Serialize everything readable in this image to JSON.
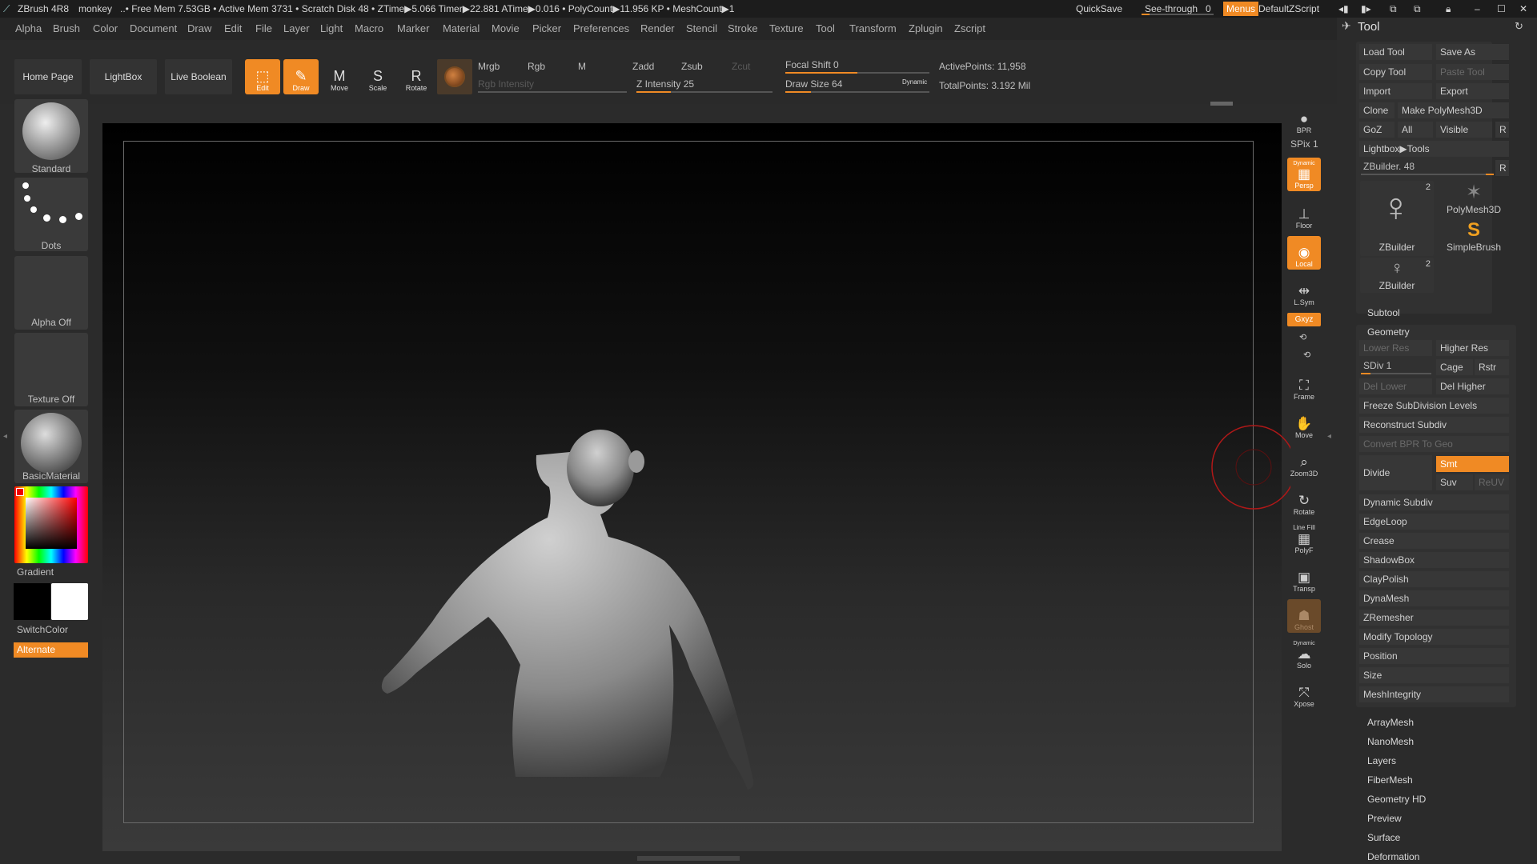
{
  "titlebar": {
    "app": "ZBrush 4R8",
    "doc": "monkey",
    "stats": "..• Free Mem 7.53GB • Active Mem 3731 • Scratch Disk 48 •  ZTime▶5.066 Timer▶22.881 ATime▶0.016 • PolyCount▶11.956 KP  • MeshCount▶1",
    "quicksave": "QuickSave",
    "seethrough": "See-through",
    "seethrough_value": "0",
    "menus": "Menus",
    "script": "DefaultZScript"
  },
  "menu": [
    "Alpha",
    "Brush",
    "Color",
    "Document",
    "Draw",
    "Edit",
    "File",
    "Layer",
    "Light",
    "Macro",
    "Marker",
    "Material",
    "Movie",
    "Picker",
    "Preferences",
    "Render",
    "Stencil",
    "Stroke",
    "Texture",
    "Tool",
    "Transform",
    "Zplugin",
    "Zscript"
  ],
  "toolbar": {
    "home": "Home Page",
    "lightbox": "LightBox",
    "live_boolean": "Live Boolean",
    "edit": "Edit",
    "draw": "Draw",
    "move": "Move",
    "scale": "Scale",
    "rotate": "Rotate",
    "mrgb": "Mrgb",
    "rgb": "Rgb",
    "m": "M",
    "rgb_intensity": "Rgb Intensity",
    "zadd": "Zadd",
    "zsub": "Zsub",
    "zcut": "Zcut",
    "z_intensity": "Z Intensity 25",
    "focal_shift": "Focal Shift 0",
    "draw_size": "Draw Size 64",
    "dynamic": "Dynamic",
    "active_points": "ActivePoints: 11,958",
    "total_points": "TotalPoints: 3.192 Mil",
    "z_intensity_value": 0.25,
    "draw_size_value": 0.18,
    "focal_shift_value": 0.5
  },
  "left": {
    "standard": "Standard",
    "dots": "Dots",
    "alpha_off": "Alpha Off",
    "texture_off": "Texture Off",
    "material": "BasicMaterial",
    "gradient": "Gradient",
    "switchcolor": "SwitchColor",
    "alternate": "Alternate"
  },
  "right": {
    "bpr": "BPR",
    "spix": "SPix 1",
    "persp": "Persp",
    "dynamic": "Dynamic",
    "floor": "Floor",
    "local": "Local",
    "lsym": "L.Sym",
    "xyz": "Gxyz",
    "frame": "Frame",
    "move": "Move",
    "zoom": "Zoom3D",
    "rotate": "Rotate",
    "linefill": "Line Fill",
    "polyf": "PolyF",
    "transp": "Transp",
    "ghost": "Ghost",
    "solo": "Solo",
    "xpose": "Xpose"
  },
  "tool": {
    "title": "Tool",
    "load": "Load Tool",
    "save_as": "Save As",
    "copy": "Copy Tool",
    "paste": "Paste Tool",
    "import": "Import",
    "export": "Export",
    "clone": "Clone",
    "make_polymesh": "Make PolyMesh3D",
    "goz": "GoZ",
    "all": "All",
    "visible": "Visible",
    "r": "R",
    "lightbox_tools": "Lightbox▶Tools",
    "zbuilder": "ZBuilder. 48",
    "thumb1": "ZBuilder",
    "thumb1_count": "2",
    "thumb2": "PolyMesh3D",
    "thumb3": "SimpleBrush",
    "thumb4": "ZBuilder",
    "thumb4_count": "2",
    "subtool": "Subtool",
    "geometry": "Geometry",
    "lower_res": "Lower Res",
    "higher_res": "Higher Res",
    "sdiv": "SDiv 1",
    "cage": "Cage",
    "rstr": "Rstr",
    "del_lower": "Del Lower",
    "del_higher": "Del Higher",
    "freeze": "Freeze SubDivision Levels",
    "reconstruct": "Reconstruct Subdiv",
    "convert_bpr": "Convert BPR To Geo",
    "divide": "Divide",
    "smt": "Smt",
    "suv": "Suv",
    "reuv": "ReUV",
    "geo_items": [
      "Dynamic Subdiv",
      "EdgeLoop",
      "Crease",
      "ShadowBox",
      "ClayPolish",
      "DynaMesh",
      "ZRemesher",
      "Modify Topology",
      "Position",
      "Size",
      "MeshIntegrity"
    ],
    "sections": [
      "ArrayMesh",
      "NanoMesh",
      "Layers",
      "FiberMesh",
      "Geometry HD",
      "Preview",
      "Surface",
      "Deformation"
    ]
  }
}
